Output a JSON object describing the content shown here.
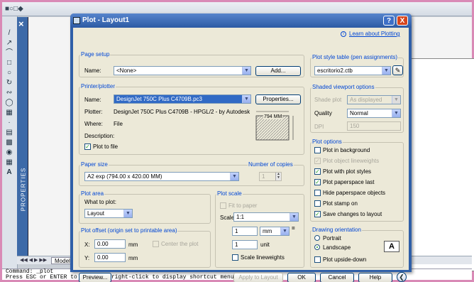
{
  "dialog": {
    "title": "Plot - Layout1",
    "help_btn": "?",
    "close_btn": "X",
    "learn_link": "Learn about Plotting"
  },
  "page_setup": {
    "title": "Page setup",
    "name_label": "Name:",
    "name_value": "<None>",
    "add_btn": "Add..."
  },
  "printer": {
    "title": "Printer/plotter",
    "name_label": "Name:",
    "name_value": "DesignJet 750C Plus C4709B.pc3",
    "properties_btn": "Properties...",
    "plotter_label": "Plotter:",
    "plotter_value": "DesignJet 750C Plus C4709B - HPGL/2 - by Autodesk",
    "where_label": "Where:",
    "where_value": "File",
    "desc_label": "Description:",
    "plot_to_file": "Plot to file",
    "paper_dim": "794 MM"
  },
  "paper_size": {
    "title": "Paper size",
    "value": "A2 exp (794.00 x 420.00 MM)"
  },
  "copies": {
    "title": "Number of copies",
    "value": "1"
  },
  "plot_area": {
    "title": "Plot area",
    "what_label": "What to plot:",
    "value": "Layout"
  },
  "plot_offset": {
    "title": "Plot offset (origin set to printable area)",
    "x_label": "X:",
    "x_value": "0.00",
    "y_label": "Y:",
    "y_value": "0.00",
    "unit": "mm",
    "center": "Center the plot"
  },
  "plot_scale": {
    "title": "Plot scale",
    "fit": "Fit to paper",
    "scale_label": "Scale:",
    "scale_value": "1:1",
    "val1": "1",
    "unit1": "mm",
    "val2": "1",
    "unit2": "unit",
    "lineweights": "Scale lineweights"
  },
  "style_table": {
    "title": "Plot style table (pen assignments)",
    "value": "escritorio2.ctb"
  },
  "shaded": {
    "title": "Shaded viewport options",
    "shade_label": "Shade plot",
    "shade_value": "As displayed",
    "quality_label": "Quality",
    "quality_value": "Normal",
    "dpi_label": "DPI",
    "dpi_value": "150"
  },
  "plot_options": {
    "title": "Plot options",
    "items": [
      {
        "label": "Plot in background",
        "checked": false,
        "disabled": false
      },
      {
        "label": "Plot object lineweights",
        "checked": true,
        "disabled": true
      },
      {
        "label": "Plot with plot styles",
        "checked": true,
        "disabled": false
      },
      {
        "label": "Plot paperspace last",
        "checked": true,
        "disabled": false
      },
      {
        "label": "Hide paperspace objects",
        "checked": false,
        "disabled": false
      },
      {
        "label": "Plot stamp on",
        "checked": false,
        "disabled": false
      },
      {
        "label": "Save changes to layout",
        "checked": true,
        "disabled": false
      }
    ]
  },
  "orientation": {
    "title": "Drawing orientation",
    "portrait": "Portrait",
    "landscape": "Landscape",
    "upside": "Plot upside-down",
    "icon_letter": "A"
  },
  "buttons": {
    "preview": "Preview...",
    "apply": "Apply to Layout",
    "ok": "OK",
    "cancel": "Cancel",
    "help": "Help"
  },
  "background": {
    "tab_model": "Model",
    "command_line1": "Command: _plot",
    "command_line2": "Press ESC or ENTER to exit, or right-click to display shortcut menu.",
    "properties_label": "PROPERTIES"
  },
  "colors": {
    "title_blue": "#2c5aa4",
    "group_title": "#0046d5",
    "selected": "#316ac5",
    "close_red": "#d6461e"
  }
}
